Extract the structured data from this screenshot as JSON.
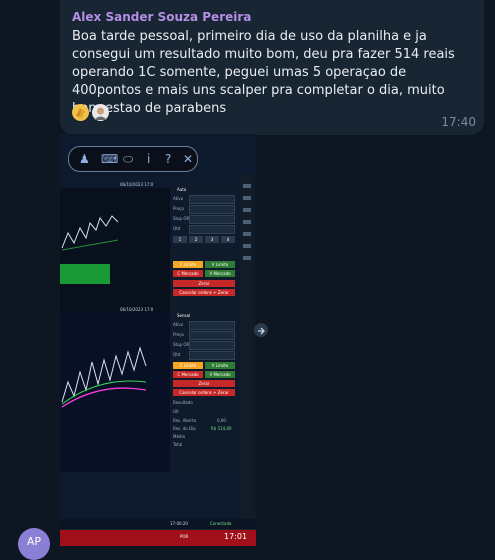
{
  "message": {
    "sender": "Alex Sander Souza Pereira",
    "text": "Boa tarde pessoal, primeiro dia de uso da planilha e ja consegui um resultado muito bom, deu pra fazer 514 reais operando 1C somente, peguei umas 5 operaçao de 400pontos e mais uns scalper pra completar o dia, muito bom estao de parabens",
    "time": "17:40",
    "reactions": [
      "clapping-hands",
      "person-avatar"
    ]
  },
  "screenshot": {
    "chart_top": {
      "symbol": "Mini",
      "date_time": "06/10/2023 17:0",
      "trade_panel": {
        "title": "Auto",
        "labels": [
          "Ativo",
          "Preço",
          "Stop OR",
          "Qtd"
        ],
        "quantity_buttons": [
          "1",
          "2",
          "3",
          "4"
        ],
        "buy_limit": "C Limite",
        "sell_limit": "V Limite",
        "buy_market": "C Mercado",
        "sell_market": "V Mercado",
        "zero": "Zerar",
        "cancel_orders": "Cancelar ordens + Zerar"
      }
    },
    "chart_bottom": {
      "symbol": "Mini",
      "date_time": "06/10/2023 17:0",
      "trade_panel": {
        "title": "Sensal",
        "labels": [
          "Ativo",
          "Preço",
          "Stop OR",
          "Qtd"
        ],
        "buy_limit": "C Limite",
        "sell_limit": "V Limite",
        "buy_market": "C Mercado",
        "sell_market": "V Mercado",
        "zero": "Zerar",
        "cancel_orders": "Cancelar ordens + Zerar",
        "results_labels": [
          "Resultado",
          "Ult",
          "Res. Aberto",
          "Res. do Dia",
          "Médio",
          "Total"
        ],
        "results_values": [
          "0,00",
          "R$ 514,00"
        ]
      }
    },
    "status_bar": {
      "time": "17:00:20",
      "connection": "Conectada"
    },
    "taskbar": {
      "lang": "POR",
      "clock": "17:01"
    }
  },
  "colors": {
    "background": "#0e1621",
    "bubble": "#182533",
    "sender": "#b38fe6",
    "buy": "#2e7d32",
    "sell": "#c62828",
    "limit_buy": "#f5a623"
  },
  "avatar_initials": "AP"
}
